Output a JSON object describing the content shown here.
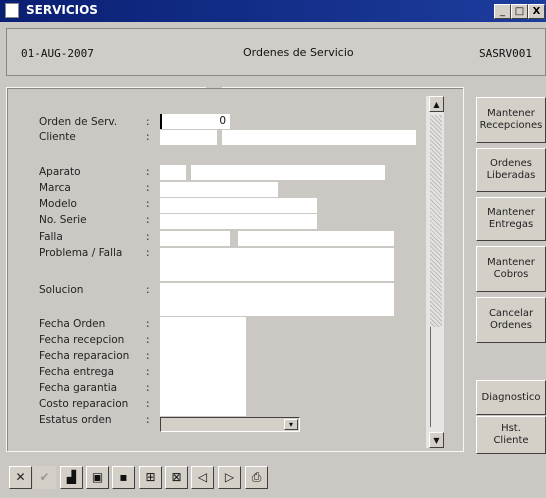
{
  "window": {
    "title": "SERVICIOS",
    "min_label": "_",
    "max_label": "□",
    "close_label": "X"
  },
  "header": {
    "date": "01-AUG-2007",
    "title": "Ordenes de Servicio",
    "code": "SASRV001"
  },
  "form": {
    "orden_label": "Orden de Serv.",
    "orden_value": "0",
    "cliente_label": "Cliente",
    "aparato_label": "Aparato",
    "marca_label": "Marca",
    "modelo_label": "Modelo",
    "serie_label": "No. Serie",
    "falla_label": "Falla",
    "problema_label": "Problema / Falla",
    "solucion_label": "Solucion",
    "fecha_orden_label": "Fecha Orden",
    "fecha_recepcion_label": "Fecha recepcion",
    "fecha_reparacion_label": "Fecha reparacion",
    "fecha_entrega_label": "Fecha entrega",
    "fecha_garantia_label": "Fecha garantia",
    "costo_label": "Costo reparacion",
    "estatus_label": "Estatus orden",
    "colon": ":"
  },
  "sidebar": {
    "recepciones": "Mantener\nRecepciones",
    "liberadas": "Ordenes\nLiberadas",
    "entregas": "Mantener\nEntregas",
    "cobros": "Mantener\nCobros",
    "cancelar": "Cancelar\nOrdenes",
    "diagnostico": "Diagnostico",
    "historial": "Hst.\nCliente"
  },
  "toolbar": {
    "cancel": "✕",
    "accept": "✔",
    "clear": "▟",
    "save": "▣",
    "exit": "▪",
    "add": "⊞",
    "delete": "⊠",
    "prev": "◁",
    "next": "▷",
    "print": "⎙"
  },
  "icons": {
    "app": "app-icon",
    "dropdown": "chevron-down-icon"
  }
}
